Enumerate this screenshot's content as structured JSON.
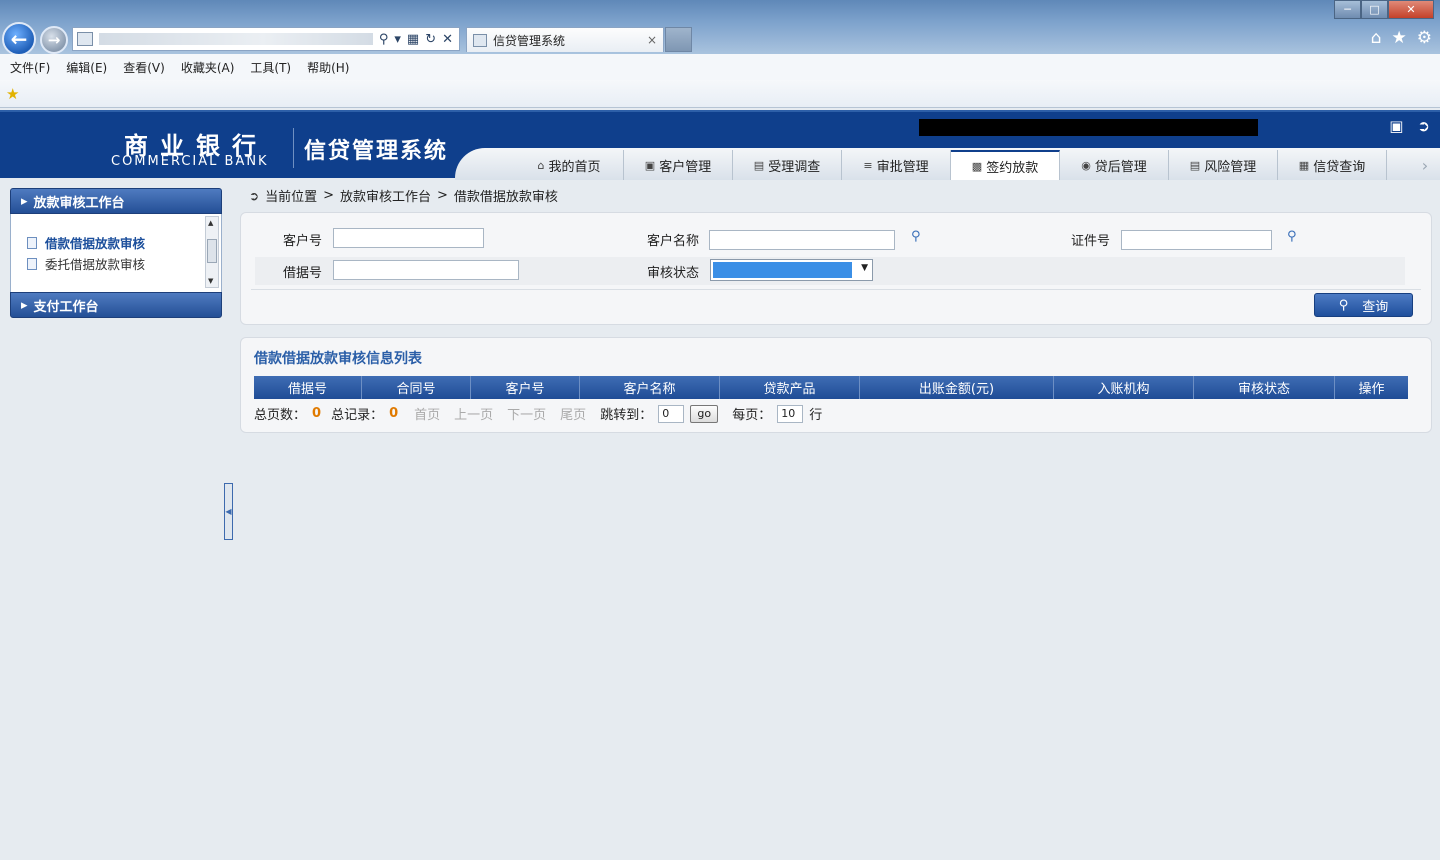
{
  "browser": {
    "tab_title": "信贷管理系统",
    "tab_close": "×",
    "menu": [
      "文件(F)",
      "编辑(E)",
      "查看(V)",
      "收藏夹(A)",
      "工具(T)",
      "帮助(H)"
    ]
  },
  "header": {
    "bank_cn": "商业银行",
    "bank_en": "COMMERCIAL BANK",
    "system_title": "信贷管理系统",
    "nav": [
      {
        "label": "我的首页",
        "icon": "home-icon"
      },
      {
        "label": "客户管理",
        "icon": "customer-icon"
      },
      {
        "label": "受理调查",
        "icon": "survey-icon"
      },
      {
        "label": "审批管理",
        "icon": "list-icon"
      },
      {
        "label": "签约放款",
        "icon": "contract-icon",
        "active": true
      },
      {
        "label": "贷后管理",
        "icon": "post-loan-icon"
      },
      {
        "label": "风险管理",
        "icon": "risk-icon"
      },
      {
        "label": "信贷查询",
        "icon": "query-icon"
      }
    ]
  },
  "sidebar": {
    "group1": "放款审核工作台",
    "items": [
      "借款借据放款审核",
      "委托借据放款审核"
    ],
    "group2": "支付工作台"
  },
  "breadcrumb": {
    "label": "当前位置",
    "sep1": ">",
    "level1": "放款审核工作台",
    "sep2": ">",
    "level2": "借款借据放款审核"
  },
  "search": {
    "customer_no_label": "客户号",
    "customer_name_label": "客户名称",
    "id_no_label": "证件号",
    "receipt_no_label": "借据号",
    "status_label": "审核状态",
    "query_button": "查询"
  },
  "list": {
    "title": "借款借据放款审核信息列表",
    "columns": [
      "借据号",
      "合同号",
      "客户号",
      "客户名称",
      "贷款产品",
      "出账金额(元)",
      "入账机构",
      "审核状态",
      "操作"
    ]
  },
  "pager": {
    "total_pages_label": "总页数：",
    "total_pages": "0",
    "total_records_label": "总记录：",
    "total_records": "0",
    "first": "首页",
    "prev": "上一页",
    "next": "下一页",
    "last": "尾页",
    "jump_label": "跳转到：",
    "jump_value": "0",
    "go": "go",
    "per_page_label": "每页：",
    "per_page": "10",
    "rows_unit": "行"
  }
}
